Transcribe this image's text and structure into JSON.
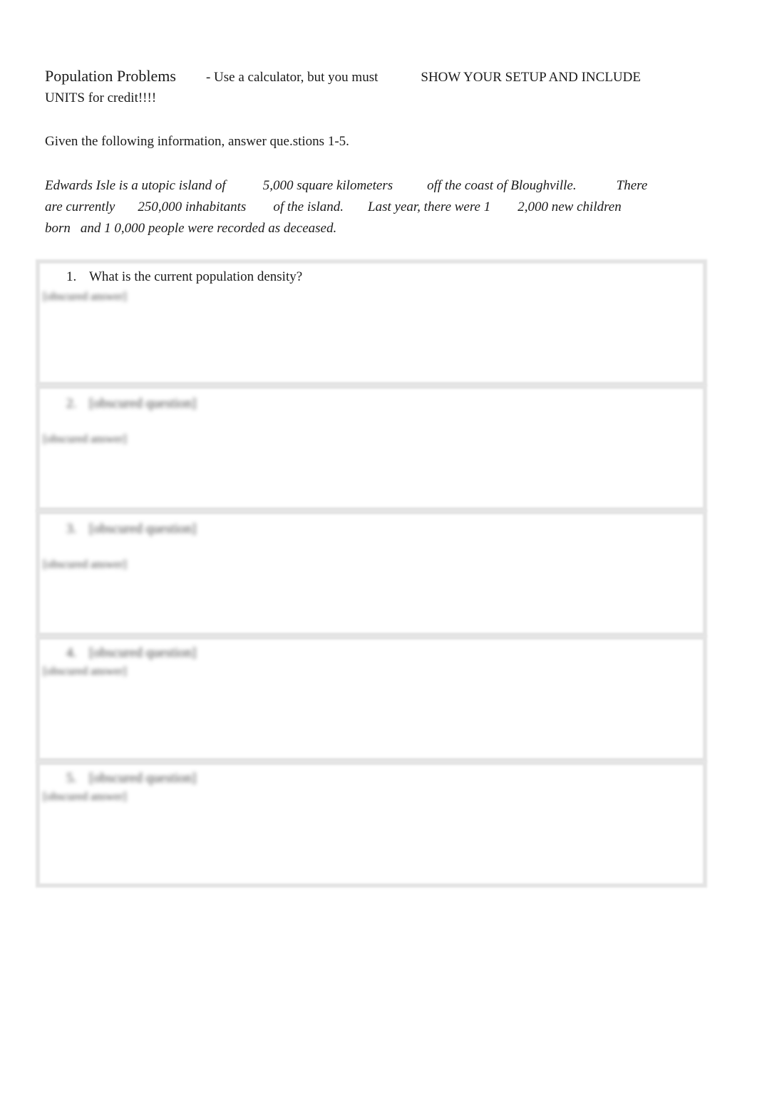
{
  "header": {
    "title": "Population Problems",
    "instruction_part1": "- Use a calculator, but you must",
    "instruction_part2": "SHOW YOUR SETUP AND INCLUDE",
    "instruction_line2": "UNITS for credit!!!!"
  },
  "intro": "Given the following information, answer que.stions 1-5.",
  "scenario": {
    "line1": [
      "Edwards Isle is a utopic island of",
      "5,000 square kilometers",
      "off the coast of Bloughville.",
      "There"
    ],
    "line2": [
      "are currently",
      "250,000 inhabitants",
      "of the island.",
      "Last year, there were 1",
      "2,000 new children"
    ],
    "line3": [
      "born",
      "and 1 0,000 people were recorded as deceased."
    ]
  },
  "questions": [
    {
      "number": "1.",
      "text": "What is the current population density?",
      "answer": "[obscured answer]",
      "blurred": false
    },
    {
      "number": "2.",
      "text": "[obscured question]",
      "answer": "[obscured answer]",
      "blurred": true
    },
    {
      "number": "3.",
      "text": "[obscured question]",
      "answer": "[obscured answer]",
      "blurred": true
    },
    {
      "number": "4.",
      "text": "[obscured question]",
      "answer": "[obscured answer]",
      "blurred": true
    },
    {
      "number": "5.",
      "text": "[obscured question]",
      "answer": "[obscured answer]",
      "blurred": true
    }
  ]
}
